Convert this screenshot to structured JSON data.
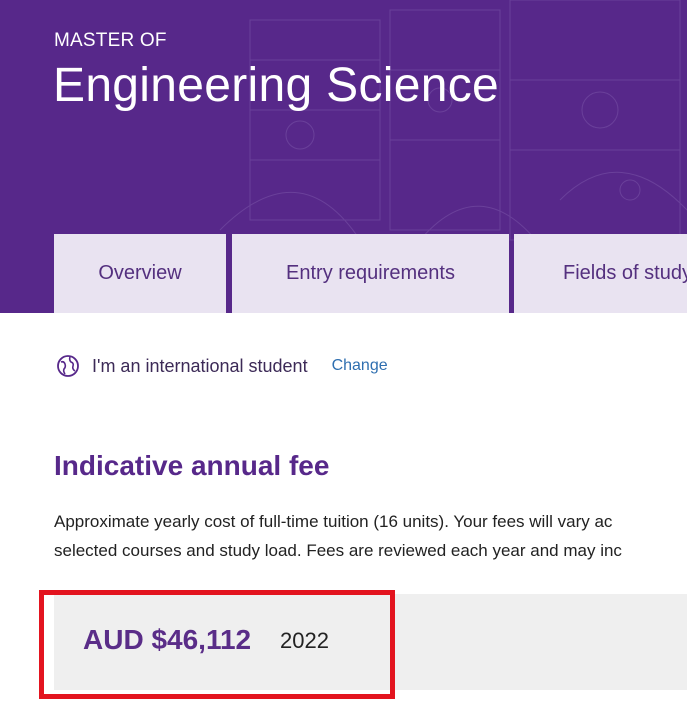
{
  "hero": {
    "eyebrow": "MASTER OF",
    "title": "Engineering Science",
    "background_color": "#57288a"
  },
  "tabs": [
    {
      "label": "Overview"
    },
    {
      "label": "Entry requirements"
    },
    {
      "label": "Fields of study"
    }
  ],
  "student_status": {
    "icon": "globe-icon",
    "text": "I'm an international student",
    "change_label": "Change"
  },
  "fees": {
    "heading": "Indicative annual fee",
    "description_line1": "Approximate yearly cost of full-time tuition (16 units). Your fees will vary ac",
    "description_line2": "selected courses and study load. Fees are reviewed each year and may inc",
    "amount": "AUD $46,112",
    "year": "2022"
  },
  "colors": {
    "brand_purple": "#57288a",
    "tab_background": "#e9e3f1",
    "link_blue": "#2f6fb0",
    "highlight_red": "#e3141f"
  }
}
